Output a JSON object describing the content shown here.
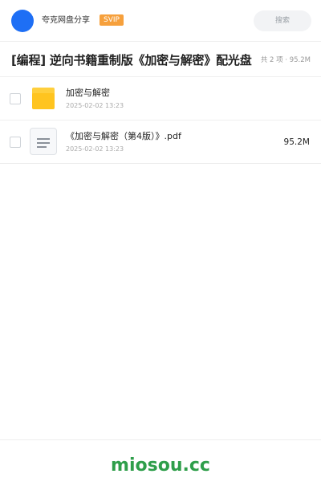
{
  "header": {
    "brand": "夸克网盘分享",
    "badge": "SVIP",
    "search_placeholder": "搜索"
  },
  "share": {
    "title": "[编程] 逆向书籍重制版《加密与解密》配光盘",
    "meta": "共 2 项 · 95.2M"
  },
  "files": [
    {
      "name": "加密与解密",
      "date": "2025-02-02 13:23",
      "size": "",
      "icon": "folder-icon"
    },
    {
      "name": "《加密与解密（第4版）》.pdf",
      "date": "2025-02-02 13:23",
      "size": "95.2M",
      "icon": "file-icon"
    }
  ],
  "footer": {
    "watermark": "miosou.cc"
  },
  "colors": {
    "accent": "#1e6ff5",
    "svip": "#f6a03c",
    "folder": "#ffc41f",
    "watermark": "#2e9e4a"
  }
}
